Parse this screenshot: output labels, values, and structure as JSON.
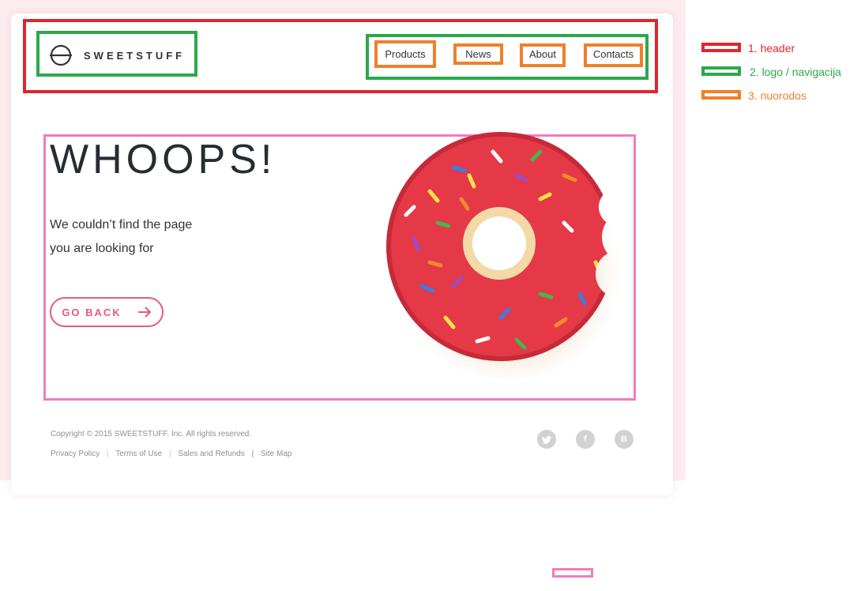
{
  "logo": {
    "text": "SWEETSTUFF"
  },
  "nav": [
    {
      "label": "Products"
    },
    {
      "label": "News"
    },
    {
      "label": "About"
    },
    {
      "label": "Contacts"
    }
  ],
  "hero": {
    "title": "WHOOPS!",
    "message_line1": "We couldn’t find the page",
    "message_line2": "you are looking for",
    "button_label": "GO BACK"
  },
  "footer": {
    "copyright": "Copyright © 2015 SWEETSTUFF. Inc. All rights reserved.",
    "links": [
      "Privacy Policy",
      "Terms of Use",
      "Sales and Refunds",
      "Site Map"
    ],
    "social": [
      "twitter-icon",
      "facebook-icon",
      "blog-icon"
    ]
  },
  "legend": [
    {
      "label": "1. header",
      "color": "#e0262f"
    },
    {
      "label": "2. logo / navigacija",
      "color": "#2aa94a"
    },
    {
      "label": "3. nuorodos",
      "color": "#f07f2a"
    }
  ],
  "colors": {
    "accent": "#e65a7b",
    "header_annotation": "#e0262f",
    "logo_nav_annotation": "#2aa94a",
    "links_annotation": "#f07f2a",
    "content_annotation": "#f07cbe"
  }
}
